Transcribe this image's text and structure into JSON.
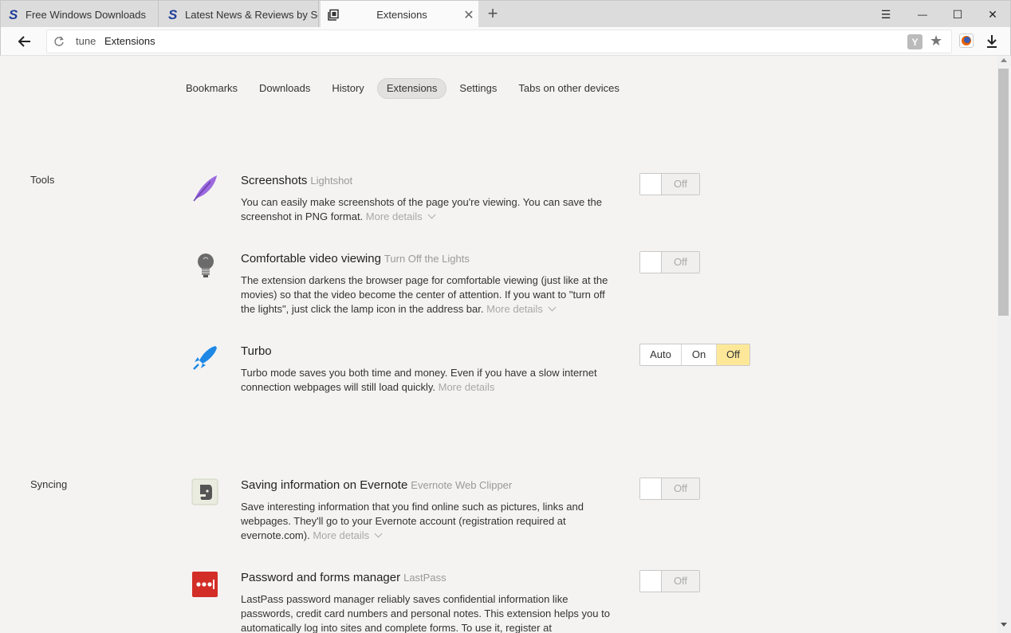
{
  "tabs": [
    {
      "title": "Free Windows Downloads",
      "favicon": "softpedia-s-icon"
    },
    {
      "title": "Latest News & Reviews by Sc",
      "favicon": "softpedia-s-icon"
    },
    {
      "title": "Extensions",
      "favicon": "tab-page-icon",
      "close": "✕"
    }
  ],
  "window": {
    "new_tab": "+",
    "menu": "☰",
    "minimize": "—",
    "maximize": "☐",
    "close": "✕"
  },
  "address": {
    "host": "tune",
    "page": "Extensions",
    "protect_badge": "Y",
    "bookmark_star": "★"
  },
  "nav": {
    "items": [
      "Bookmarks",
      "Downloads",
      "History",
      "Extensions",
      "Settings",
      "Tabs on other devices"
    ],
    "active": "Extensions"
  },
  "sections": {
    "tools": {
      "label": "Tools",
      "screenshots": {
        "name": "Screenshots",
        "source": "Lightshot",
        "desc": "You can easily make screenshots of the page you're viewing. You can save the screenshot in PNG format.",
        "more": "More details",
        "state": "Off"
      },
      "video": {
        "name": "Comfortable video viewing",
        "source": "Turn Off the Lights",
        "desc": "The extension darkens the browser page for comfortable viewing (just like at the movies) so that the video become the center of attention. If you want to \"turn off the lights\", just click the lamp icon in the address bar.",
        "more": "More details",
        "state": "Off"
      },
      "turbo": {
        "name": "Turbo",
        "desc": "Turbo mode saves you both time and money. Even if you have a slow internet connection webpages will still load quickly.",
        "more": "More details",
        "options": [
          "Auto",
          "On",
          "Off"
        ],
        "selected": "Off"
      }
    },
    "syncing": {
      "label": "Syncing",
      "evernote": {
        "name": "Saving information on Evernote",
        "source": "Evernote Web Clipper",
        "desc": "Save interesting information that you find online such as pictures, links and webpages. They'll go to your Evernote account (registration required at evernote.com).",
        "more": "More details",
        "state": "Off"
      },
      "lastpass": {
        "name": "Password and forms manager",
        "source": "LastPass",
        "desc": "LastPass password manager reliably saves confidential information like passwords, credit card numbers and personal notes. This extension helps you to automatically log into sites and complete forms. To use it, register at",
        "state": "Off"
      }
    }
  },
  "colors": {
    "accent_selected": "#fde89a",
    "page_bg": "#f4f3f2",
    "lastpass_red": "#d32d27",
    "turbo_blue": "#1e88e5"
  }
}
